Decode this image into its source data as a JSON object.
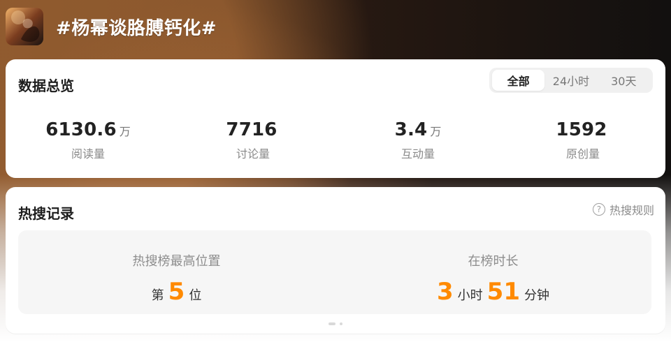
{
  "header": {
    "title": "#杨幂谈胳膊钙化#"
  },
  "overview": {
    "title": "数据总览",
    "tabs": [
      {
        "label": "全部",
        "active": true
      },
      {
        "label": "24小时",
        "active": false
      },
      {
        "label": "30天",
        "active": false
      }
    ],
    "stats": [
      {
        "value": "6130.6",
        "unit": "万",
        "label": "阅读量"
      },
      {
        "value": "7716",
        "unit": "",
        "label": "讨论量"
      },
      {
        "value": "3.4",
        "unit": "万",
        "label": "互动量"
      },
      {
        "value": "1592",
        "unit": "",
        "label": "原创量"
      }
    ]
  },
  "hot_record": {
    "title": "热搜记录",
    "rules_label": "热搜规则",
    "rules_icon": "question-circle-icon",
    "left": {
      "label": "热搜榜最高位置",
      "prefix": "第",
      "value": "5",
      "suffix": "位"
    },
    "right": {
      "label": "在榜时长",
      "hours": "3",
      "hours_unit": "小时",
      "minutes": "51",
      "minutes_unit": "分钟"
    }
  },
  "colors": {
    "accent": "#ff8a00",
    "card": "#ffffff",
    "panel": "#f6f6f6"
  }
}
